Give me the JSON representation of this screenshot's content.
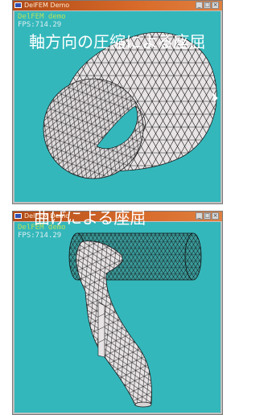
{
  "windows": [
    {
      "title": "DelFEM Demo",
      "overlay_line1": "DelFEM demo",
      "overlay_line2": "FPS:714.29",
      "caption": "軸方向の圧縮による座屈"
    },
    {
      "title": "DelFEM Demo",
      "overlay_line1": "DelFEM demo",
      "overlay_line2": "FPS:714.29",
      "caption": "曲げによる座屈"
    }
  ],
  "controls": {
    "minimize": "_",
    "maximize": "□",
    "close": "×"
  },
  "colors": {
    "viewport_bg": "#34b7bb",
    "mesh_fill": "#e8e4e6",
    "mesh_edge": "#1a1a1a",
    "overlay_text": "#b8e060"
  },
  "icons": [
    "app-icon",
    "minimize-icon",
    "maximize-icon",
    "close-icon"
  ]
}
